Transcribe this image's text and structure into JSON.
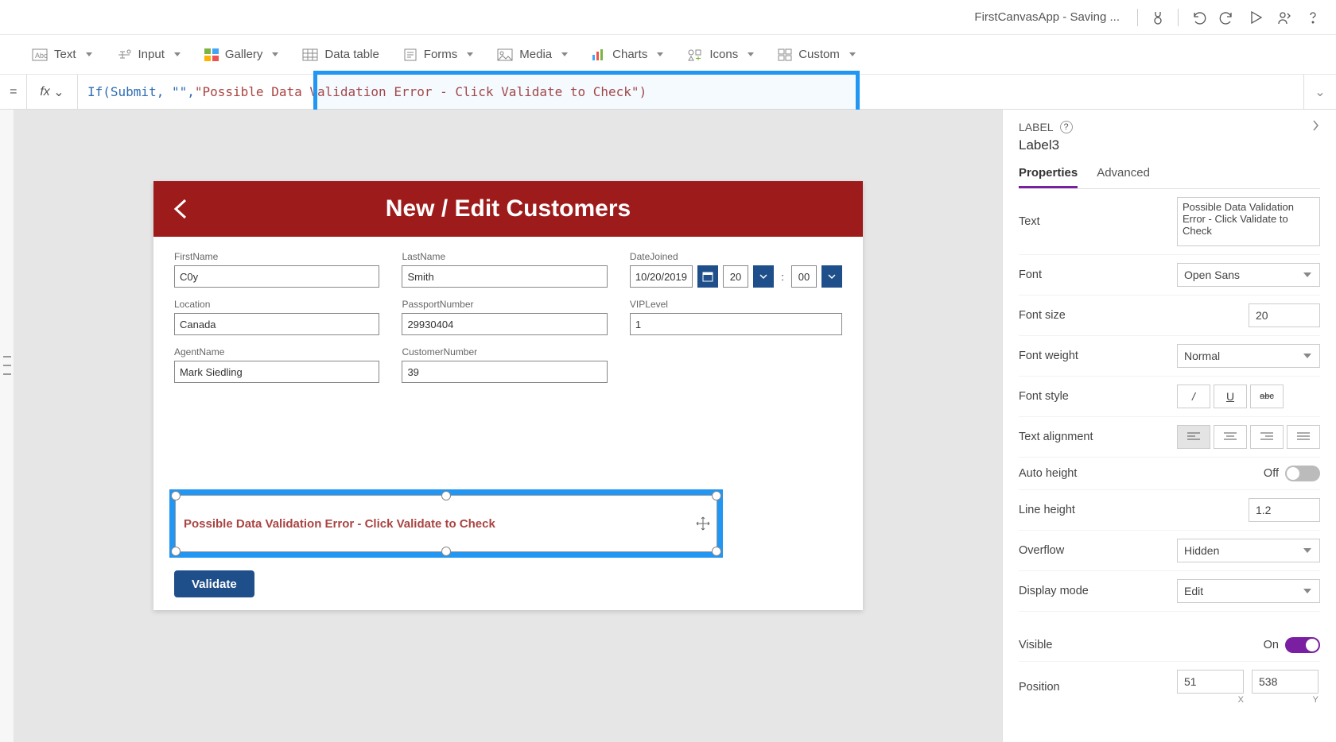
{
  "header": {
    "app_title": "FirstCanvasApp - Saving ..."
  },
  "ribbon": {
    "text": "Text",
    "input": "Input",
    "gallery": "Gallery",
    "datatable": "Data table",
    "forms": "Forms",
    "media": "Media",
    "charts": "Charts",
    "icons": "Icons",
    "custom": "Custom"
  },
  "formula": {
    "eq": "=",
    "fx": "fx",
    "part1": "If(Submit, \"\", ",
    "part2": "\"Possible Data Validation Error - Click Validate to Check\")"
  },
  "canvas": {
    "title": "New / Edit Customers",
    "fields": {
      "firstname_lbl": "FirstName",
      "firstname_val": "C0y",
      "lastname_lbl": "LastName",
      "lastname_val": "Smith",
      "datejoined_lbl": "DateJoined",
      "datejoined_val": "10/20/2019",
      "date_hour": "20",
      "date_min": "00",
      "time_sep": ":",
      "location_lbl": "Location",
      "location_val": "Canada",
      "passport_lbl": "PassportNumber",
      "passport_val": "29930404",
      "vip_lbl": "VIPLevel",
      "vip_val": "1",
      "agent_lbl": "AgentName",
      "agent_val": "Mark Siedling",
      "custnum_lbl": "CustomerNumber",
      "custnum_val": "39"
    },
    "validation_msg": "Possible Data Validation Error - Click Validate to Check",
    "validate_btn": "Validate"
  },
  "props": {
    "panel_label": "LABEL",
    "control_name": "Label3",
    "tab_properties": "Properties",
    "tab_advanced": "Advanced",
    "text_lbl": "Text",
    "text_val": "Possible Data Validation Error - Click Validate to Check",
    "font_lbl": "Font",
    "font_val": "Open Sans",
    "fontsize_lbl": "Font size",
    "fontsize_val": "20",
    "fontweight_lbl": "Font weight",
    "fontweight_val": "Normal",
    "fontstyle_lbl": "Font style",
    "fontstyle_italic": "/",
    "fontstyle_underline": "U",
    "fontstyle_strike": "abc",
    "align_lbl": "Text alignment",
    "autoheight_lbl": "Auto height",
    "autoheight_val": "Off",
    "lineheight_lbl": "Line height",
    "lineheight_val": "1.2",
    "overflow_lbl": "Overflow",
    "overflow_val": "Hidden",
    "displaymode_lbl": "Display mode",
    "displaymode_val": "Edit",
    "visible_lbl": "Visible",
    "visible_val": "On",
    "position_lbl": "Position",
    "position_x": "51",
    "position_y": "538",
    "position_xlbl": "X",
    "position_ylbl": "Y"
  }
}
